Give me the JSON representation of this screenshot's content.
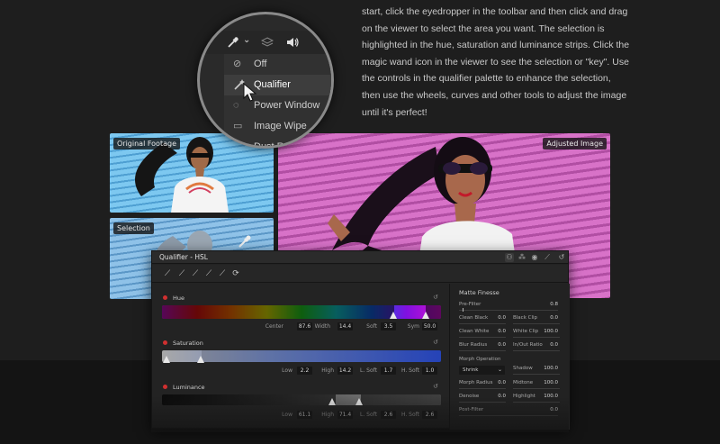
{
  "paragraph": "start, click the eyedropper in the toolbar and then click and drag on the viewer to select the area you want. The selection is highlighted in the hue, saturation and luminance strips. Click the magic wand icon in the viewer to see the selection or \"key\". Use the controls in the qualifier palette to enhance the selection, then use the wheels, curves and other tools to adjust the image until it's perfect!",
  "panels": {
    "original": "Original Footage",
    "selection": "Selection",
    "adjusted": "Adjusted Image"
  },
  "magnifier": {
    "toolbar_icons": [
      "eyedropper-icon",
      "chevron-down-icon",
      "layers-icon",
      "speaker-icon"
    ],
    "menu": [
      {
        "label": "Off",
        "icon": "off-icon",
        "active": false
      },
      {
        "label": "Qualifier",
        "icon": "qualifier-icon",
        "active": true
      },
      {
        "label": "Power Window",
        "icon": "power-window-icon",
        "active": false
      },
      {
        "label": "Image Wipe",
        "icon": "image-wipe-icon",
        "active": false
      },
      {
        "label": "Dust Re",
        "icon": "dust-removal-icon",
        "active": false
      }
    ]
  },
  "qualifier": {
    "title": "Qualifier - HSL",
    "hue": {
      "label": "Hue",
      "params": [
        {
          "label": "Center",
          "value": "87.6"
        },
        {
          "label": "Width",
          "value": "14.4"
        },
        {
          "label": "Soft",
          "value": "3.5"
        },
        {
          "label": "Sym",
          "value": "50.0"
        }
      ]
    },
    "saturation": {
      "label": "Saturation",
      "params": [
        {
          "label": "Low",
          "value": "2.2"
        },
        {
          "label": "High",
          "value": "14.2"
        },
        {
          "label": "L. Soft",
          "value": "1.7"
        },
        {
          "label": "H. Soft",
          "value": "1.0"
        }
      ]
    },
    "luminance": {
      "label": "Luminance",
      "params": [
        {
          "label": "Low",
          "value": "61.1"
        },
        {
          "label": "High",
          "value": "71.4"
        },
        {
          "label": "L. Soft",
          "value": "2.6"
        },
        {
          "label": "H. Soft",
          "value": "2.6"
        }
      ]
    },
    "matte": {
      "title": "Matte Finesse",
      "pre_filter_label": "Pre-Filter",
      "pre_filter_value": "0.8",
      "clean_black_label": "Clean Black",
      "clean_black_value": "0.0",
      "black_clip_label": "Black Clip",
      "black_clip_value": "0.0",
      "clean_white_label": "Clean White",
      "clean_white_value": "0.0",
      "white_clip_label": "White Clip",
      "white_clip_value": "100.0",
      "blur_radius_label": "Blur Radius",
      "blur_radius_value": "0.0",
      "in_out_ratio_label": "In/Out Ratio",
      "in_out_ratio_value": "0.0",
      "morph_op_label": "Morph Operation",
      "morph_select": "Shrink",
      "shadow_label": "Shadow",
      "shadow_value": "100.0",
      "morph_radius_label": "Morph Radius",
      "morph_radius_value": "0.0",
      "midtone_label": "Midtone",
      "midtone_value": "100.0",
      "denoise_label": "Denoise",
      "denoise_value": "0.0",
      "highlight_label": "Highlight",
      "highlight_value": "100.0",
      "post_filter_label": "Post-Filter",
      "post_filter_value": "0.0"
    }
  }
}
